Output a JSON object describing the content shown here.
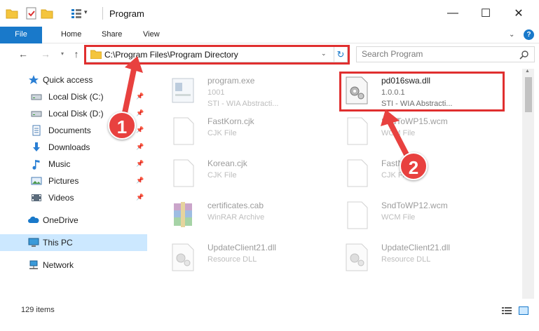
{
  "window": {
    "title": "Program",
    "minimize_glyph": "—",
    "maximize_glyph": "☐",
    "close_glyph": "✕"
  },
  "ribbon": {
    "tabs": [
      "File",
      "Home",
      "Share",
      "View"
    ],
    "help_glyph": "?"
  },
  "navigation": {
    "address": "C:\\Program Files\\Program Directory",
    "search_placeholder": "Search Program"
  },
  "sidebar": {
    "items": [
      {
        "label": "Quick access",
        "icon": "star-icon",
        "pinned": false
      },
      {
        "label": "Local Disk (C:)",
        "icon": "drive-icon",
        "pinned": true
      },
      {
        "label": "Local Disk (D:)",
        "icon": "drive-icon",
        "pinned": true
      },
      {
        "label": "Documents",
        "icon": "documents-icon",
        "pinned": true
      },
      {
        "label": "Downloads",
        "icon": "download-icon",
        "pinned": true
      },
      {
        "label": "Music",
        "icon": "music-icon",
        "pinned": true
      },
      {
        "label": "Pictures",
        "icon": "pictures-icon",
        "pinned": true
      },
      {
        "label": "Videos",
        "icon": "videos-icon",
        "pinned": true
      },
      {
        "label": "OneDrive",
        "icon": "cloud-icon",
        "pinned": false
      },
      {
        "label": "This PC",
        "icon": "computer-icon",
        "pinned": false
      },
      {
        "label": "Network",
        "icon": "network-icon",
        "pinned": false
      }
    ]
  },
  "files": [
    {
      "name": "program.exe",
      "line1": "1001",
      "line2": "STI - WIA Abstracti...",
      "icon": "exe-icon",
      "active": false
    },
    {
      "name": "pd016swa.dll",
      "line1": "1.0.0.1",
      "line2": "STI - WIA Abstracti...",
      "icon": "dll-gear-icon",
      "active": true
    },
    {
      "name": "FastKorn.cjk",
      "line1": "CJK File",
      "line2": "",
      "icon": "file-icon",
      "active": false
    },
    {
      "name": "SndToWP15.wcm",
      "line1": "WCM File",
      "line2": "",
      "icon": "file-icon",
      "active": false
    },
    {
      "name": "Korean.cjk",
      "line1": "CJK File",
      "line2": "",
      "icon": "file-icon",
      "active": false
    },
    {
      "name": "FastNi...",
      "line1": "CJK File",
      "line2": "",
      "icon": "file-icon",
      "active": false
    },
    {
      "name": "certificates.cab",
      "line1": "WinRAR Archive",
      "line2": "",
      "icon": "winrar-icon",
      "active": false
    },
    {
      "name": "SndToWP12.wcm",
      "line1": "WCM File",
      "line2": "",
      "icon": "file-icon",
      "active": false
    },
    {
      "name": "UpdateClient21.dll",
      "line1": "Resource DLL",
      "line2": "",
      "icon": "dll-gear-icon",
      "active": false
    },
    {
      "name": "UpdateClient21.dll",
      "line1": "Resource DLL",
      "line2": "",
      "icon": "dll-gear-icon",
      "active": false
    }
  ],
  "status": {
    "item_count": "129 items"
  },
  "annotations": {
    "step1": "1",
    "step2": "2",
    "color": "#e02f2f"
  },
  "colors": {
    "accent": "#1979ca",
    "selection": "#cce8ff",
    "highlight": "#e02f2f"
  }
}
